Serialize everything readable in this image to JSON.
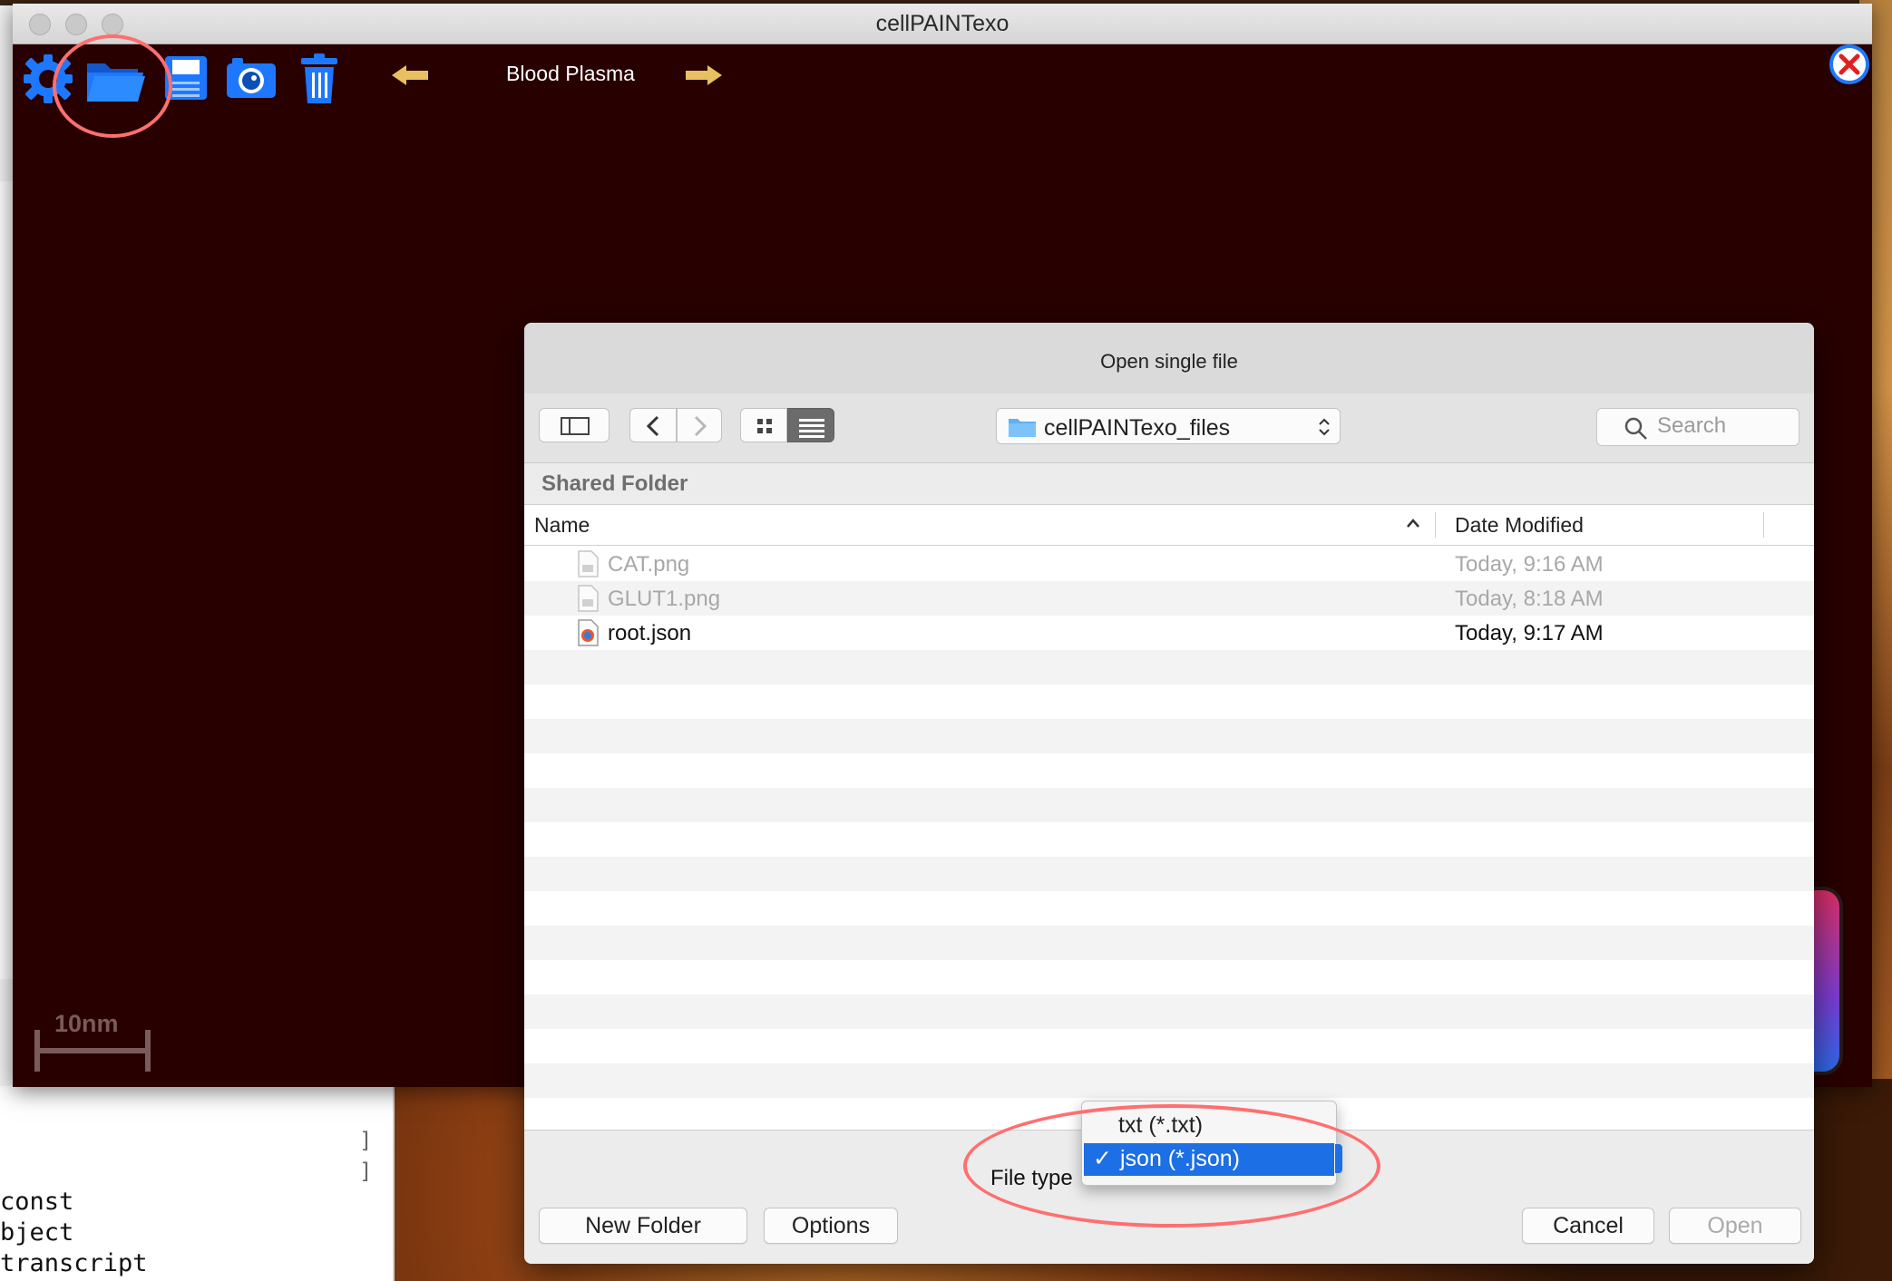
{
  "app": {
    "title": "cellPAINTexo",
    "nav_label": "Blood Plasma",
    "scale_bar": "10nm",
    "toolbar_icons": [
      "gear-icon",
      "folder-open-icon",
      "floppy-disk-icon",
      "camera-icon",
      "trash-icon",
      "arrow-left-icon",
      "arrow-right-icon",
      "close-circle-icon"
    ]
  },
  "dialog": {
    "title": "Open single file",
    "location": "cellPAINTexo_files",
    "search_placeholder": "Search",
    "section_heading": "Shared Folder",
    "columns": {
      "name": "Name",
      "date": "Date Modified"
    },
    "files": [
      {
        "name": "CAT.png",
        "date": "Today, 9:16 AM",
        "enabled": false,
        "icon": "image-file-icon"
      },
      {
        "name": "GLUT1.png",
        "date": "Today, 8:18 AM",
        "enabled": false,
        "icon": "image-file-icon"
      },
      {
        "name": "root.json",
        "date": "Today, 9:17 AM",
        "enabled": true,
        "icon": "json-file-icon"
      }
    ],
    "file_type_label": "File type",
    "file_type_options": [
      "txt (*.txt)",
      "json (*.json)"
    ],
    "file_type_selected": "json (*.json)",
    "buttons": {
      "new_folder": "New Folder",
      "options": "Options",
      "cancel": "Cancel",
      "open": "Open"
    }
  },
  "editor": {
    "bottom_lines": [
      "const",
      "bject",
      "transcript"
    ]
  },
  "colors": {
    "app_bg": "#280000",
    "accent_blue": "#1d6fe5",
    "callout": "#ff6f6f",
    "icon_blue": "#1e78ff"
  }
}
